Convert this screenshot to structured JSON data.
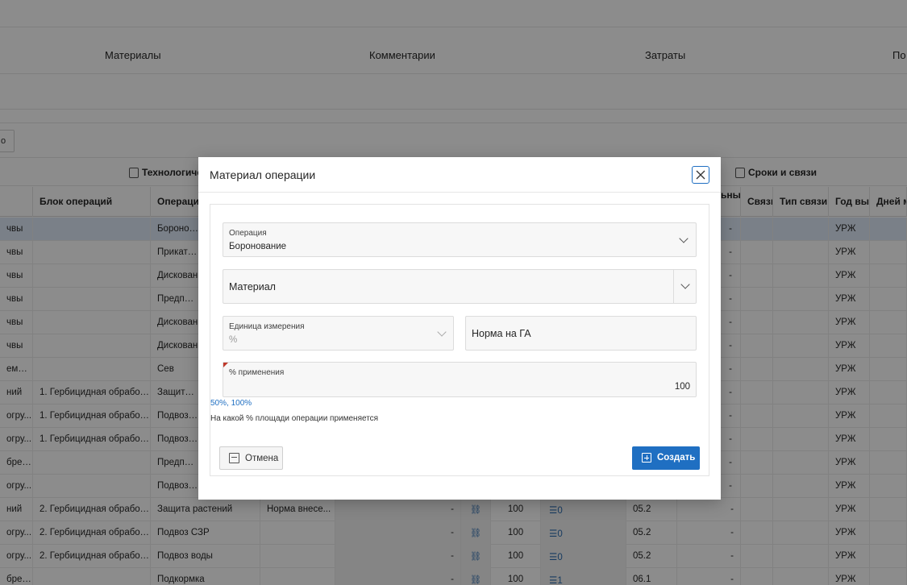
{
  "background": {
    "tabs": [
      "Материалы",
      "Комментарии",
      "Затраты",
      "По"
    ],
    "toolbar_button_fragment": "о",
    "groups": [
      "Технологичес",
      "Сроки и связи"
    ],
    "headers": [
      "Блок операций",
      "Операци",
      "ьный дня",
      "Связь",
      "Тип связи",
      "Год вып",
      "Дней м"
    ],
    "rows": [
      {
        "c0": "чвы",
        "c1": "",
        "c2": "Боронова",
        "sv": "-",
        "year": "УРЖ"
      },
      {
        "c0": "чвы",
        "c1": "",
        "c2": "Прикатыв",
        "sv": "-",
        "year": "УРЖ"
      },
      {
        "c0": "чвы",
        "c1": "",
        "c2": "Дискован",
        "sv": "-",
        "year": "УРЖ"
      },
      {
        "c0": "чвы",
        "c1": "",
        "c2": "Предпосе",
        "sv": "-",
        "year": "УРЖ"
      },
      {
        "c0": "чвы",
        "c1": "",
        "c2": "Дискован",
        "sv": "-",
        "year": "УРЖ"
      },
      {
        "c0": "чвы",
        "c1": "",
        "c2": "Дискован",
        "sv": "-",
        "year": "УРЖ"
      },
      {
        "c0": "емян ...",
        "c1": "",
        "c2": "Сев",
        "sv": "-",
        "year": "УРЖ"
      },
      {
        "c0": "ний",
        "c1": "1. Гербицидная обработ...",
        "c2": "Защита ра",
        "sv": "-",
        "year": "УРЖ"
      },
      {
        "c0": "огру...",
        "c1": "1. Гербицидная обработ...",
        "c2": "Подвоз во",
        "sv": "-",
        "year": "УРЖ"
      },
      {
        "c0": "огру...",
        "c1": "1. Гербицидная обработ...",
        "c2": "Подвоз СЗ",
        "sv": "-",
        "year": "УРЖ"
      },
      {
        "c0": "брен...",
        "c1": "",
        "c2": "Предпосе",
        "sv": "-",
        "year": "УРЖ"
      },
      {
        "c0": "огру...",
        "c1": "",
        "c2": "Подвоз се",
        "sv": "-",
        "year": "УРЖ"
      }
    ],
    "full_rows": [
      {
        "c0": "ний",
        "c1": "2. Гербицидная обработ...",
        "c2": "Защита растений",
        "c3": "Норма внесе...",
        "dash": "-",
        "pct": "100",
        "cnt": "0",
        "code": "05.2",
        "sv": "-",
        "year": "УРЖ"
      },
      {
        "c0": "огру...",
        "c1": "2. Гербицидная обработ...",
        "c2": "Подвоз СЗР",
        "c3": "",
        "dash": "-",
        "pct": "100",
        "cnt": "0",
        "code": "05.2",
        "sv": "-",
        "year": "УРЖ"
      },
      {
        "c0": "огру...",
        "c1": "2. Гербицидная обработ...",
        "c2": "Подвоз воды",
        "c3": "",
        "dash": "-",
        "pct": "100",
        "cnt": "0",
        "code": "05.2",
        "sv": "-",
        "year": "УРЖ"
      },
      {
        "c0": "брен...",
        "c1": "",
        "c2": "Подкормка",
        "c3": "",
        "dash": "-",
        "pct": "100",
        "cnt": "1",
        "code": "06.1",
        "sv": "-",
        "year": "УРЖ"
      }
    ]
  },
  "dialog": {
    "title": "Материал операции",
    "operation": {
      "label": "Операция",
      "value": "Боронование"
    },
    "material": {
      "placeholder": "Материал"
    },
    "unit": {
      "label": "Единица измерения",
      "value": "%"
    },
    "norm": {
      "placeholder": "Норма на ГА"
    },
    "percent": {
      "label": "% применения",
      "value": "100"
    },
    "hint_link": "50%, 100%",
    "hint_text": "На какой % площади операции применяется",
    "cancel_label": "Отмена",
    "create_label": "Создать"
  },
  "colors": {
    "primary": "#1f6fc2",
    "required": "#c0392b",
    "selected_row": "#dfe9f7"
  }
}
